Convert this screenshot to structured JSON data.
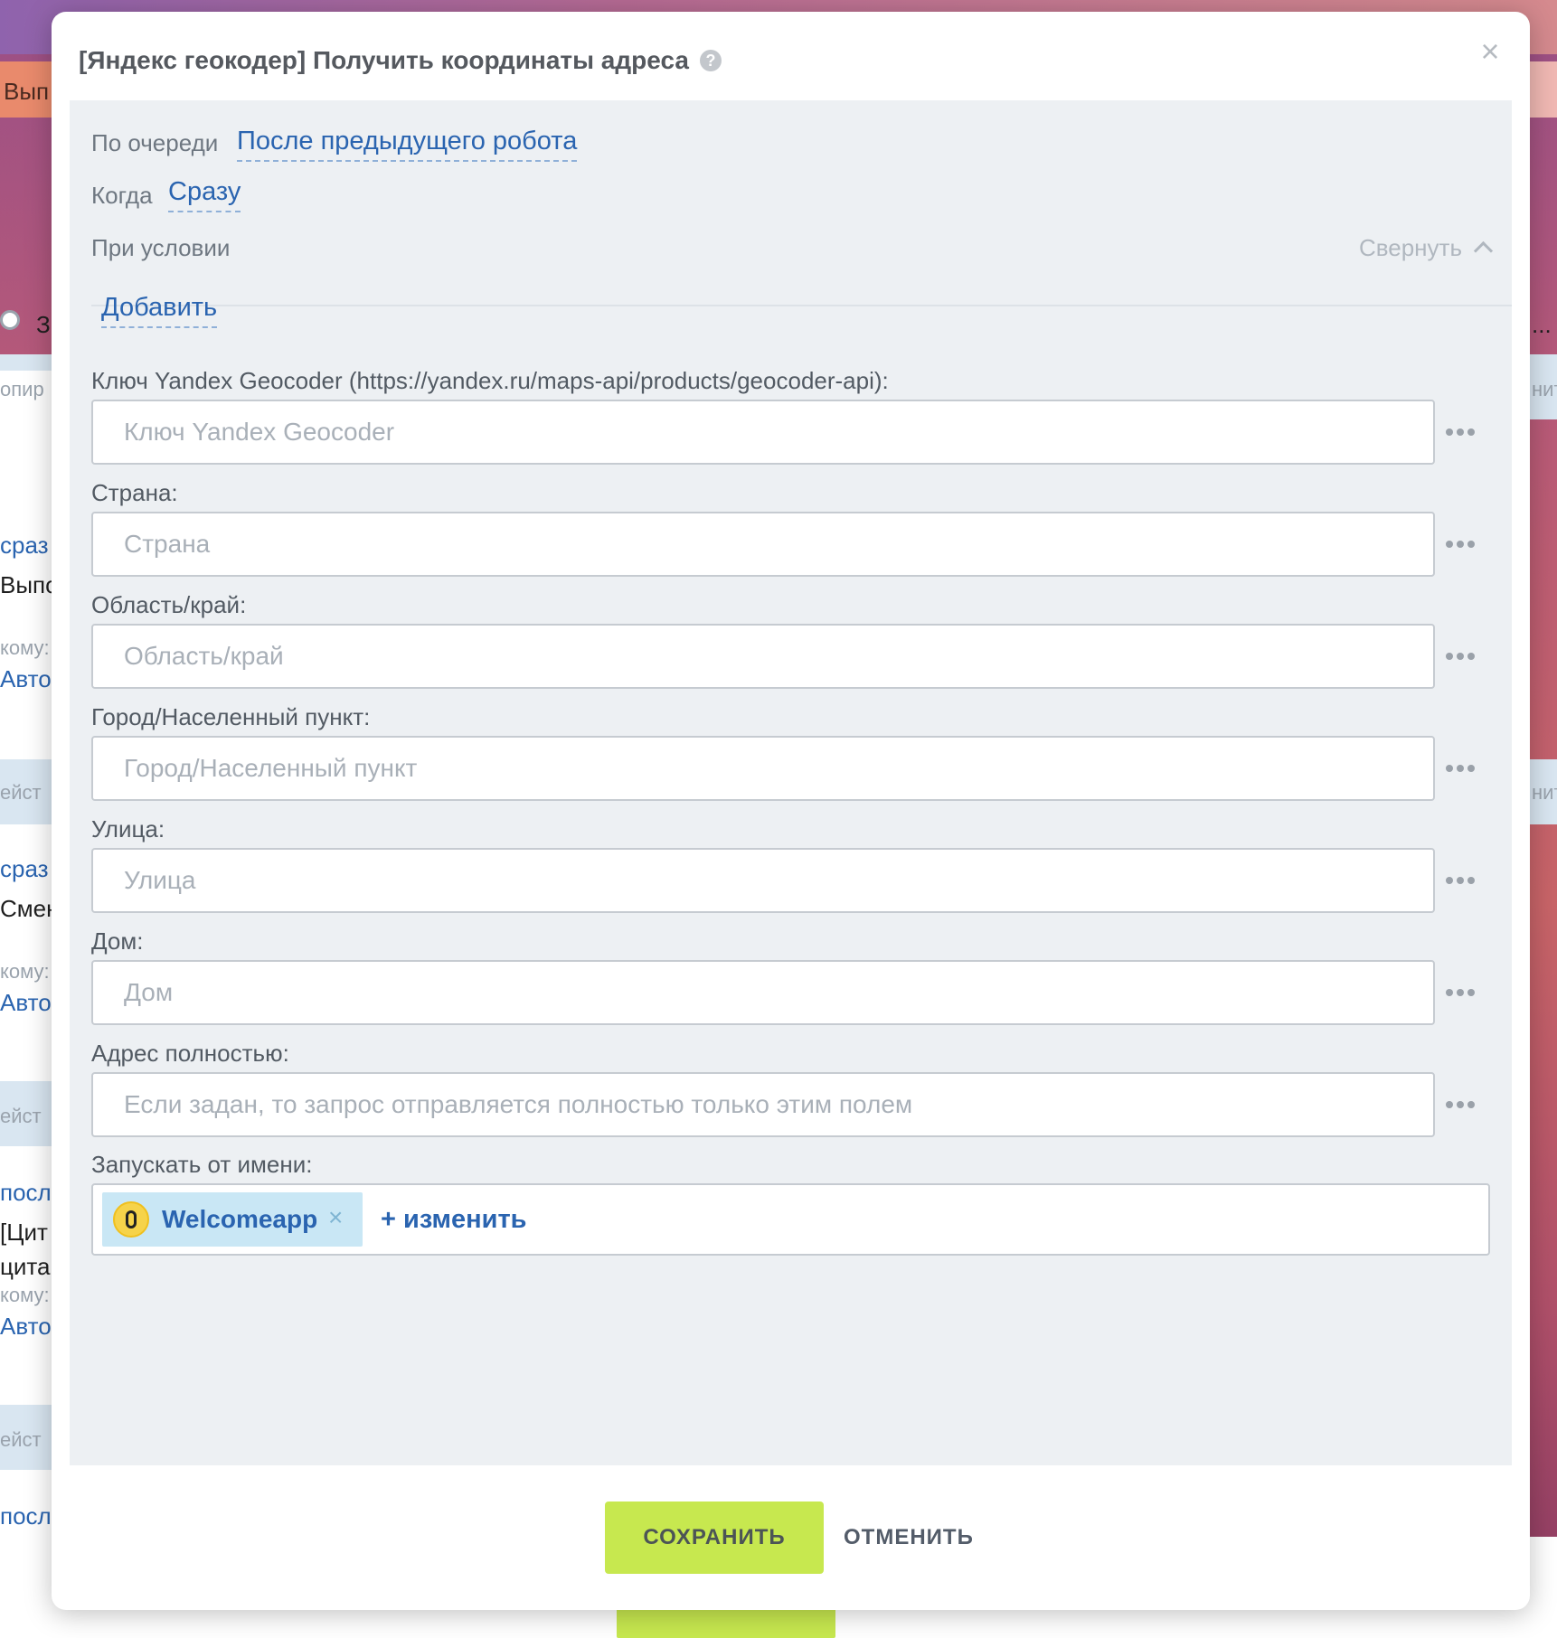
{
  "background": {
    "fragments": [
      "Вып",
      "З",
      "опир",
      "нит",
      "сраз",
      "Выпо",
      "кому:",
      "Авто",
      "ейст",
      "нит",
      "сраз",
      "Смен",
      "кому:",
      "Авто",
      "ейст",
      "посл",
      "[Цит",
      "цита",
      "кому:",
      "Авто",
      "ейст",
      "посл",
      "..."
    ]
  },
  "modal": {
    "title": "[Яндекс геокодер] Получить координаты адреса",
    "help_icon": "question-circle-icon",
    "close_icon": "close-icon"
  },
  "settings": {
    "queue_label": "По очереди",
    "queue_value": "После предыдущего робота",
    "when_label": "Когда",
    "when_value": "Сразу",
    "condition_label": "При условии",
    "collapse_label": "Свернуть",
    "add_label": "Добавить"
  },
  "fields": {
    "api_key": {
      "label": "Ключ Yandex Geocoder (https://yandex.ru/maps-api/products/geocoder-api):",
      "placeholder": "Ключ Yandex Geocoder"
    },
    "country": {
      "label": "Страна:",
      "placeholder": "Страна"
    },
    "region": {
      "label": "Область/край:",
      "placeholder": "Область/край"
    },
    "city": {
      "label": "Город/Населенный пункт:",
      "placeholder": "Город/Населенный пункт"
    },
    "street": {
      "label": "Улица:",
      "placeholder": "Улица"
    },
    "house": {
      "label": "Дом:",
      "placeholder": "Дом"
    },
    "full_address": {
      "label": "Адрес полностью:",
      "placeholder": "Если задан, то запрос отправляется полностью только этим полем"
    }
  },
  "run_as": {
    "label": "Запускать от имени:",
    "user_name": "Welcomeapp",
    "remove_symbol": "×",
    "change_label": "+ изменить"
  },
  "buttons": {
    "save": "СОХРАНИТЬ",
    "cancel": "ОТМЕНИТЬ"
  },
  "colors": {
    "accent": "#c7e84f",
    "link": "#2a64b0",
    "panel": "#edf0f3"
  }
}
